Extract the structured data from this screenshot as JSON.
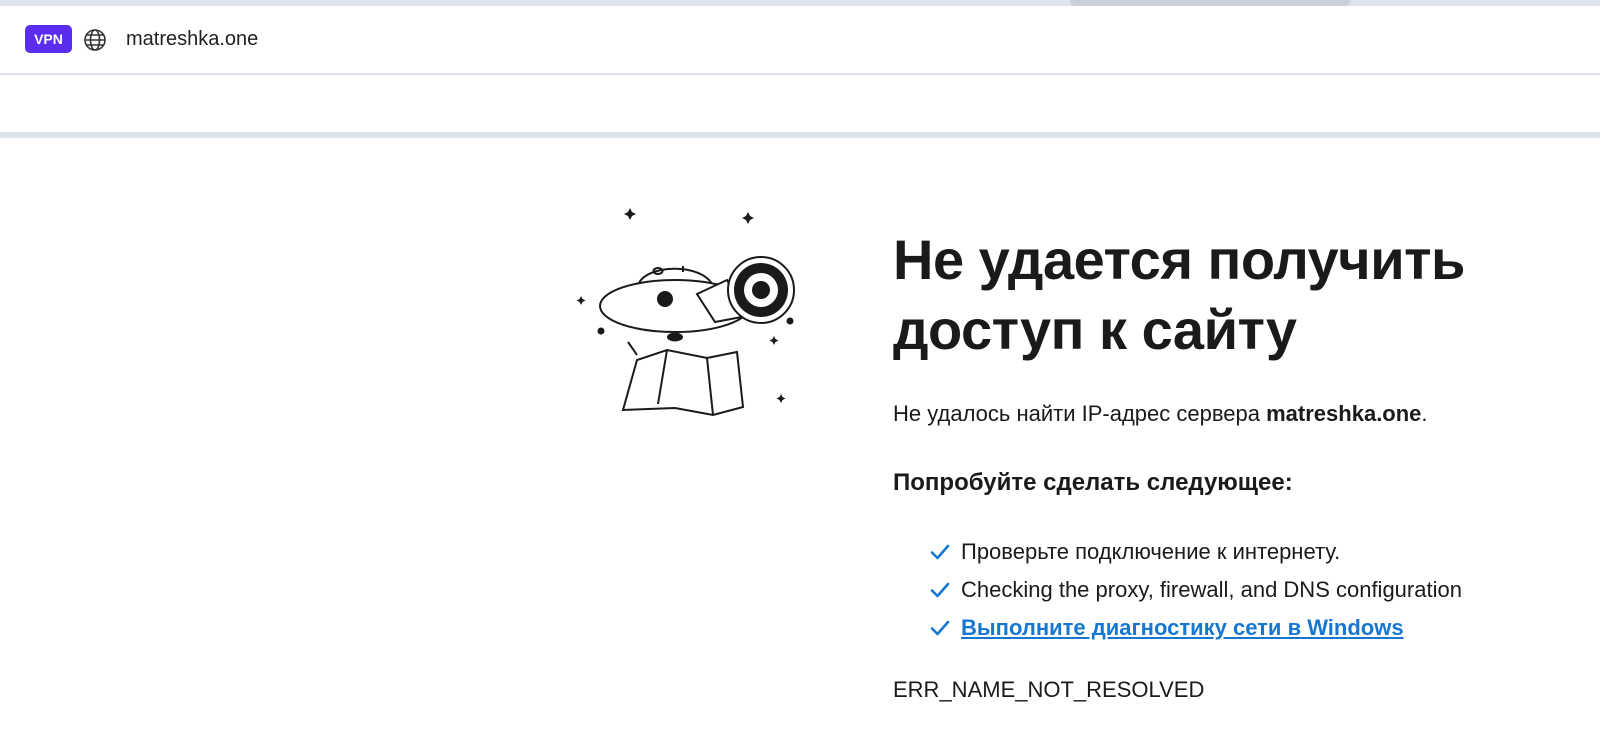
{
  "browser": {
    "vpn_badge": "VPN",
    "url": "matreshka.one"
  },
  "error_page": {
    "title": "Не удается получить доступ к сайту",
    "summary_prefix": "Не удалось найти IP-адрес сервера ",
    "summary_host": "matreshka.one",
    "summary_suffix": ".",
    "suggestions_title": "Попробуйте сделать следующее:",
    "suggestions": [
      "Проверьте подключение к интернету.",
      "Checking the proxy, firewall, and DNS configuration",
      "Выполните диагностику сети в Windows"
    ],
    "error_code": "ERR_NAME_NOT_RESOLVED"
  },
  "colors": {
    "vpn_badge": "#5a2df0",
    "link": "#1677d2",
    "check": "#1677d2"
  },
  "icons": [
    "globe-icon",
    "check-icon",
    "telescope-illustration"
  ]
}
